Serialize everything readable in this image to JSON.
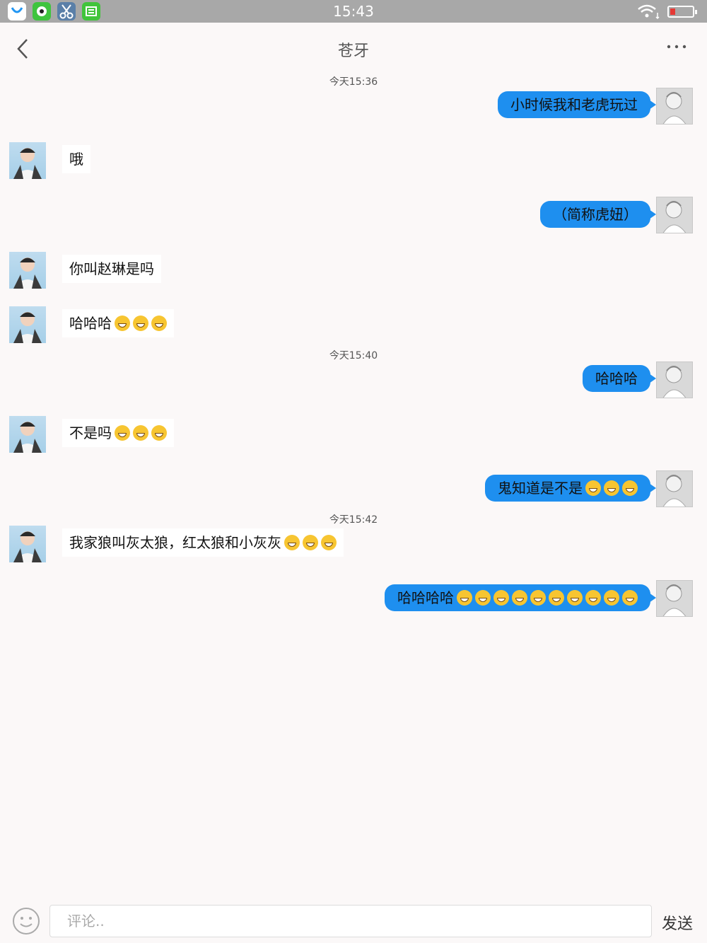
{
  "status_bar": {
    "time": "15:43",
    "app_icons": [
      {
        "icon": "browser-app-icon",
        "color": "#ffffff"
      },
      {
        "icon": "camera-app-icon",
        "color": "#3ec43e"
      },
      {
        "icon": "scissors-app-icon",
        "color": "#5a7fa8"
      },
      {
        "icon": "green-app-icon",
        "color": "#41c43b"
      }
    ],
    "battery_color": "#e53935"
  },
  "nav": {
    "title": "苍牙",
    "back_icon": "chevron-left-icon",
    "more_icon": "more-dots-icon"
  },
  "timestamps": [
    "今天15:36",
    "今天15:40",
    "今天15:42"
  ],
  "messages": [
    {
      "side": "out",
      "text": "小时候我和老虎玩过",
      "emoji": 0
    },
    {
      "side": "in",
      "text": "哦",
      "emoji": 0
    },
    {
      "side": "out",
      "text": "（简称虎妞）",
      "emoji": 0
    },
    {
      "side": "in",
      "text": "你叫赵琳是吗",
      "emoji": 0
    },
    {
      "side": "in",
      "text": "哈哈哈",
      "emoji": 3
    },
    {
      "side": "out",
      "text": "哈哈哈",
      "emoji": 0
    },
    {
      "side": "in",
      "text": "不是吗",
      "emoji": 3
    },
    {
      "side": "out",
      "text": "鬼知道是不是",
      "emoji": 3
    },
    {
      "side": "in",
      "text": "我家狼叫灰太狼，红太狼和小灰灰",
      "emoji": 3
    },
    {
      "side": "out",
      "text": "哈哈哈哈",
      "emoji": 10
    }
  ],
  "emoji_name": "grinning-tears-emoji",
  "bubble_out_color": "#1e8fef",
  "input": {
    "placeholder": "评论..",
    "value": "",
    "send_label": "发送",
    "emoji_button_icon": "smiley-icon"
  }
}
